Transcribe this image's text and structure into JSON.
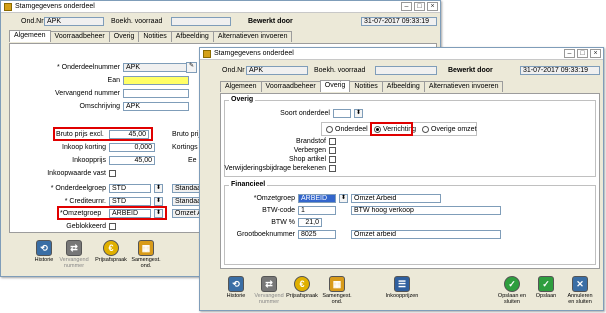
{
  "back": {
    "title": "Stamgegevens onderdeel",
    "ond_nr_label": "Ond.Nr",
    "ond_nr_value": "APK",
    "boekh_label": "Boekh. voorraad",
    "bewerkt_label": "Bewerkt door",
    "datetime": "31-07-2017 09:33:19",
    "tabs": [
      "Algemeen",
      "Voorraadbeheer",
      "Overig",
      "Notities",
      "Afbeelding",
      "Alternatieven invoeren"
    ],
    "fields": {
      "onderdeelnummer_label": "Onderdeelnummer",
      "onderdeelnummer_value": "APK",
      "ean_label": "Ean",
      "vervangend_label": "Vervangend nummer",
      "omschrijving_label": "Omschrijving",
      "omschrijving_value": "APK",
      "bruto_label": "Bruto prijs excl.",
      "bruto_value": "45,00",
      "inkoopkorting_label": "Inkoop korting",
      "inkoopkorting_value": "0,000",
      "inkoopprijs_label": "Inkoopprijs",
      "inkoopprijs_value": "45,00",
      "inkoopwaarde_label": "Inkoopwaarde vast",
      "onderdeelgroep_label": "Onderdeelgroep",
      "onderdeelgroep_value": "STD",
      "onderdeelgroep_desc": "Standaa",
      "crediteur_label": "Crediteurnr.",
      "crediteur_value": "STD",
      "crediteur_desc": "Standaa",
      "omzetgroep_label": "Omzetgroep",
      "omzetgroep_value": "ARBEID",
      "omzetgroep_desc": "Omzet A",
      "geblokkeerd_label": "Geblokkeerd",
      "right_bruto_label": "Bruto prijs",
      "right_kortings_label": "Kortings",
      "right_ee_label": "Ee"
    },
    "toolbar": [
      {
        "label": "Historie",
        "icon": "history-icon"
      },
      {
        "label": "Vervangend nummer",
        "icon": "replace-icon"
      },
      {
        "label": "Prijsafspraak",
        "icon": "coin-icon"
      },
      {
        "label": "Samengest. ond.",
        "icon": "parts-icon"
      }
    ]
  },
  "front": {
    "title": "Stamgegevens onderdeel",
    "ond_nr_label": "Ond.Nr",
    "ond_nr_value": "APK",
    "boekh_label": "Boekh. voorraad",
    "bewerkt_label": "Bewerkt door",
    "datetime": "31-07-2017 09:33:19",
    "tabs": [
      "Algemeen",
      "Voorraadbeheer",
      "Overig",
      "Notities",
      "Afbeelding",
      "Alternatieven invoeren"
    ],
    "active_tab": "Overig",
    "overig": {
      "group_title": "Overig",
      "soort_label": "Soort onderdeel",
      "radio_onderdeel": "Onderdeel",
      "radio_verrichting": "Verrichting",
      "radio_overige": "Overige omzet",
      "brandstof_label": "Brandstof",
      "verbergen_label": "Verbergen",
      "shop_label": "Shop artikel",
      "verwijdering_label": "Verwijderingsbijdrage berekenen"
    },
    "financieel": {
      "group_title": "Financieel",
      "omzetgroep_label": "Omzetgroep",
      "omzetgroep_value": "ARBEID",
      "omzetgroep_desc": "Omzet Arbeid",
      "btw_code_label": "BTW-code",
      "btw_code_value": "1",
      "btw_code_desc": "BTW hoog verkoop",
      "btw_pct_label": "BTW %",
      "btw_pct_value": "21,0",
      "grootboek_label": "Grootboeknummer",
      "grootboek_value": "8025",
      "grootboek_desc": "Omzet arbeid"
    },
    "toolbar_left": [
      {
        "label": "Historie",
        "icon": "history-icon",
        "enabled": true
      },
      {
        "label": "Vervangend nummer",
        "icon": "replace-icon",
        "enabled": false
      },
      {
        "label": "Prijsafspraak",
        "icon": "coin-icon",
        "enabled": true
      },
      {
        "label": "Samengest. ond.",
        "icon": "parts-icon",
        "enabled": true
      }
    ],
    "toolbar_mid": {
      "label": "Inkoopprijzen",
      "icon": "price-list-icon"
    },
    "toolbar_right": [
      {
        "label": "Opslaan en sluiten",
        "icon": "save-close-icon"
      },
      {
        "label": "Opslaan",
        "icon": "save-icon"
      },
      {
        "label": "Annuleren en sluiten",
        "icon": "cancel-close-icon"
      }
    ]
  },
  "colors": {
    "highlight": "#e00000",
    "yellow_field": "#ffff66",
    "selected": "#3366cc"
  }
}
